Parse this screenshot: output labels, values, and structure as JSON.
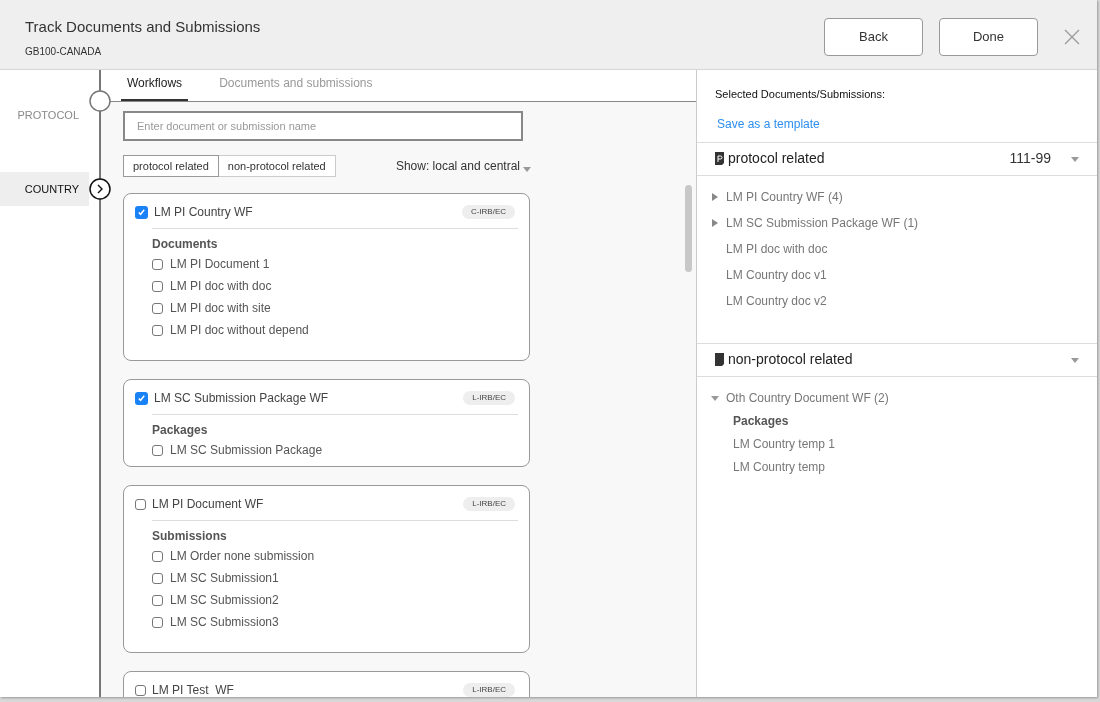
{
  "window": {
    "title": "Track Documents and Submissions",
    "subtitle": "GB100-CANADA"
  },
  "header_buttons": [
    "Back",
    "Done"
  ],
  "steps": [
    {
      "label": "PROTOCOL",
      "selected": false
    },
    {
      "label": "COUNTRY",
      "selected": true
    }
  ],
  "tabs": [
    {
      "label": "Workflows",
      "selected": true
    },
    {
      "label": "Documents and submissions",
      "selected": false
    }
  ],
  "search": {
    "placeholder": "Enter document or submission name"
  },
  "filters": [
    {
      "label": "protocol related",
      "selected": true
    },
    {
      "label": "non-protocol related",
      "selected": false
    }
  ],
  "show_dropdown": "Show: local and central",
  "workflows": [
    {
      "title": "LM PI Country WF",
      "checked": true,
      "badge": "C-IRB/EC",
      "section": "Documents",
      "items": [
        {
          "label": "LM PI Document 1",
          "checked": false
        },
        {
          "label": "LM PI doc with doc",
          "checked": false
        },
        {
          "label": "LM PI doc with site",
          "checked": false
        },
        {
          "label": "LM PI doc without depend",
          "checked": false
        }
      ]
    },
    {
      "title": "LM SC Submission Package WF",
      "checked": true,
      "badge": "L-IRB/EC",
      "section": "Packages",
      "items": [
        {
          "label": "LM SC Submission Package",
          "checked": false
        }
      ]
    },
    {
      "title": "LM PI Document WF",
      "checked": false,
      "badge": "L-IRB/EC",
      "section": "Submissions",
      "items": [
        {
          "label": "LM Order none submission",
          "checked": false
        },
        {
          "label": "LM SC Submission1",
          "checked": false
        },
        {
          "label": "LM SC Submission2",
          "checked": false
        },
        {
          "label": "LM SC Submission3",
          "checked": false
        }
      ]
    },
    {
      "title": "LM PI Test  WF",
      "checked": false,
      "badge": "L-IRB/EC"
    }
  ],
  "selected_panel": {
    "heading": "Selected Documents/Submissions:",
    "link": "Save as a template",
    "groups": [
      {
        "title": "protocol related",
        "code": "111-99",
        "items": [
          {
            "label": "LM PI Country WF (4)",
            "kind": "folder",
            "expanded": false
          },
          {
            "label": "LM SC Submission Package WF (1)",
            "kind": "folder",
            "expanded": false
          },
          {
            "label": "LM PI doc with doc",
            "kind": "leaf"
          },
          {
            "label": "LM Country doc v1",
            "kind": "leaf"
          },
          {
            "label": "LM Country doc v2",
            "kind": "leaf"
          }
        ]
      },
      {
        "title": "non-protocol related",
        "items": [
          {
            "label": "Oth Country Document WF (2)",
            "kind": "folder",
            "expanded": true,
            "section": "Packages",
            "children": [
              {
                "label": "LM Country temp 1"
              },
              {
                "label": "LM Country temp"
              }
            ]
          }
        ]
      }
    ]
  }
}
